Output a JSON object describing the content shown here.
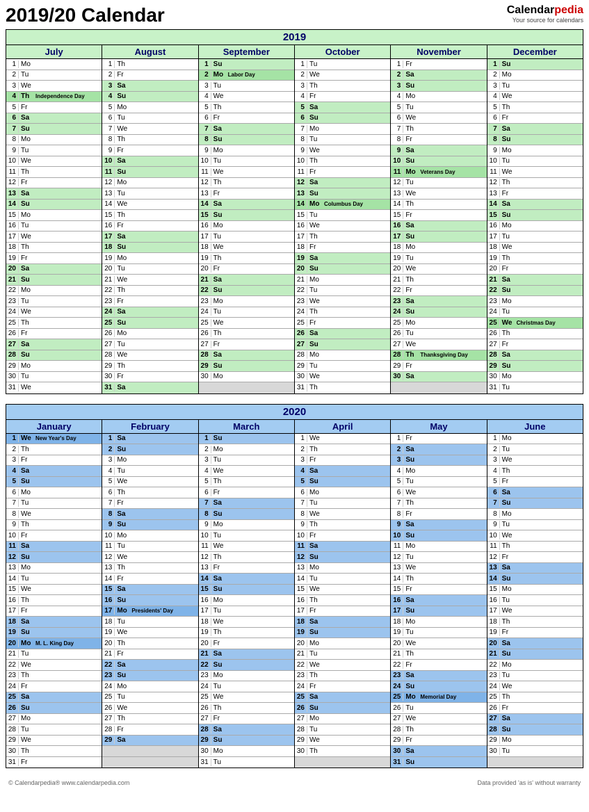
{
  "title": "2019/20 Calendar",
  "logo": {
    "part1": "Calendar",
    "part2": "pedia",
    "tagline": "Your source for calendars"
  },
  "dow": [
    "Su",
    "Mo",
    "Tu",
    "We",
    "Th",
    "Fr",
    "Sa"
  ],
  "years": [
    {
      "year": "2019",
      "class": "y2019",
      "months": [
        {
          "name": "July",
          "days": 31,
          "startDow": 1,
          "holidays": {
            "4": "Independence Day"
          }
        },
        {
          "name": "August",
          "days": 31,
          "startDow": 4,
          "holidays": {}
        },
        {
          "name": "September",
          "days": 30,
          "startDow": 0,
          "holidays": {
            "2": "Labor Day"
          }
        },
        {
          "name": "October",
          "days": 31,
          "startDow": 2,
          "holidays": {
            "14": "Columbus Day"
          }
        },
        {
          "name": "November",
          "days": 30,
          "startDow": 5,
          "holidays": {
            "11": "Veterans Day",
            "28": "Thanksgiving Day"
          }
        },
        {
          "name": "December",
          "days": 31,
          "startDow": 0,
          "holidays": {
            "25": "Christmas Day"
          }
        }
      ]
    },
    {
      "year": "2020",
      "class": "y2020",
      "months": [
        {
          "name": "January",
          "days": 31,
          "startDow": 3,
          "holidays": {
            "1": "New Year's Day",
            "20": "M. L. King Day"
          }
        },
        {
          "name": "February",
          "days": 29,
          "startDow": 6,
          "holidays": {
            "17": "Presidents' Day"
          }
        },
        {
          "name": "March",
          "days": 31,
          "startDow": 0,
          "holidays": {}
        },
        {
          "name": "April",
          "days": 30,
          "startDow": 3,
          "holidays": {}
        },
        {
          "name": "May",
          "days": 31,
          "startDow": 5,
          "holidays": {
            "25": "Memorial Day"
          }
        },
        {
          "name": "June",
          "days": 30,
          "startDow": 1,
          "holidays": {}
        }
      ]
    }
  ],
  "footer": {
    "left": "© Calendarpedia®   www.calendarpedia.com",
    "right": "Data provided 'as is' without warranty"
  }
}
